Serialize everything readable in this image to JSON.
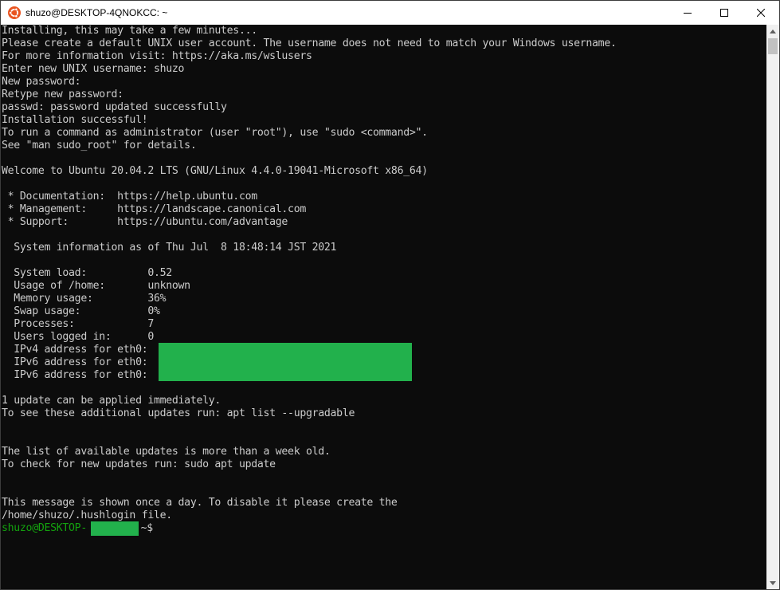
{
  "window": {
    "title": "shuzo@DESKTOP-4QNOKCC: ~",
    "icon": "ubuntu-icon",
    "controls": [
      "minimize-icon",
      "maximize-icon",
      "close-icon"
    ]
  },
  "terminal": {
    "lines": [
      "Installing, this may take a few minutes...",
      "Please create a default UNIX user account. The username does not need to match your Windows username.",
      "For more information visit: https://aka.ms/wslusers",
      "Enter new UNIX username: shuzo",
      "New password:",
      "Retype new password:",
      "passwd: password updated successfully",
      "Installation successful!",
      "To run a command as administrator (user \"root\"), use \"sudo <command>\".",
      "See \"man sudo_root\" for details.",
      "",
      "Welcome to Ubuntu 20.04.2 LTS (GNU/Linux 4.4.0-19041-Microsoft x86_64)",
      "",
      " * Documentation:  https://help.ubuntu.com",
      " * Management:     https://landscape.canonical.com",
      " * Support:        https://ubuntu.com/advantage",
      "",
      "  System information as of Thu Jul  8 18:48:14 JST 2021",
      "",
      "  System load:          0.52",
      "  Usage of /home:       unknown",
      "  Memory usage:         36%",
      "  Swap usage:           0%",
      "  Processes:            7",
      "  Users logged in:      0",
      "  IPv4 address for eth0:",
      "  IPv6 address for eth0:",
      "  IPv6 address for eth0:",
      "",
      "1 update can be applied immediately.",
      "To see these additional updates run: apt list --upgradable",
      "",
      "",
      "The list of available updates is more than a week old.",
      "To check for new updates run: sudo apt update",
      "",
      "",
      "This message is shown once a day. To disable it please create the",
      "/home/shuzo/.hushlogin file."
    ],
    "prompt": {
      "user_host": "shuzo@DESKTOP-",
      "path_symbol": ":~$"
    }
  },
  "colors": {
    "background": "#0c0c0c",
    "text": "#cccccc",
    "prompt": "#13a10e",
    "redaction": "#22b14c"
  }
}
